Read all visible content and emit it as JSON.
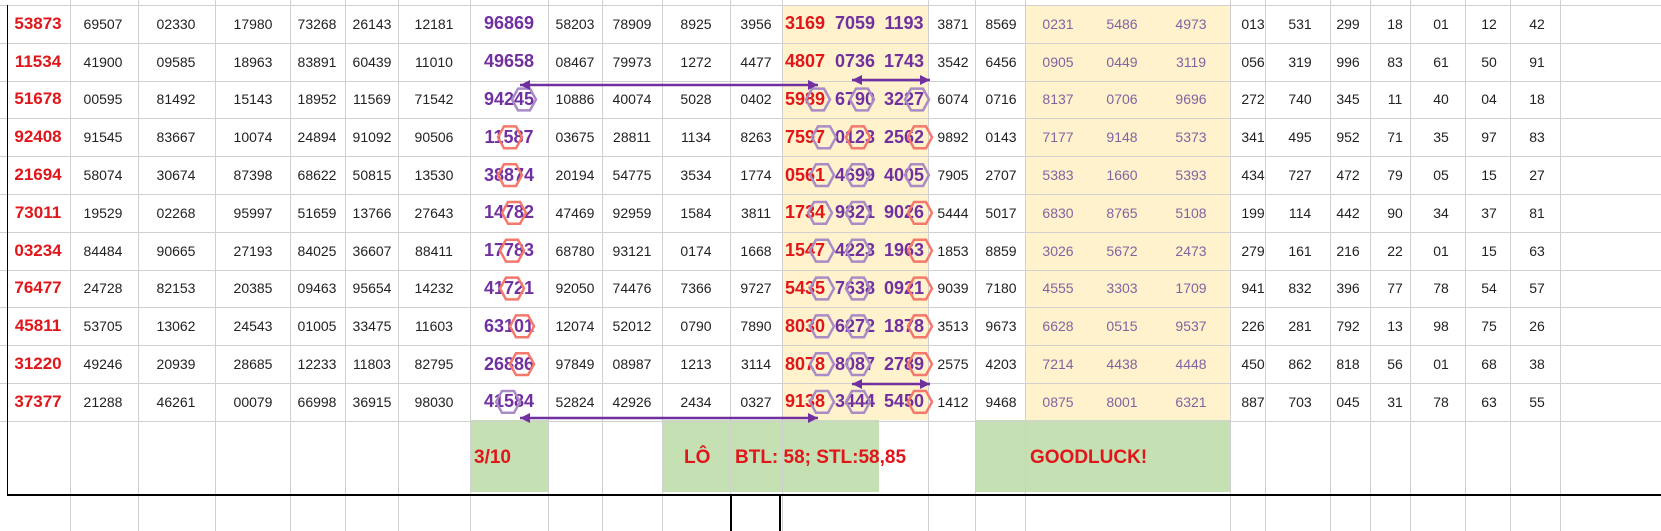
{
  "rows": [
    [
      "53873",
      "69507",
      "02330",
      "17980",
      "73268",
      "26143",
      "12181",
      "96869",
      "58203",
      "78909",
      "8925",
      "3956",
      "3169",
      "7059",
      "1193",
      "3871",
      "8569",
      "0231",
      "5486",
      "4973",
      "013",
      "531",
      "299",
      "18",
      "01",
      "12",
      "42"
    ],
    [
      "11534",
      "41900",
      "09585",
      "18963",
      "83891",
      "60439",
      "11010",
      "49658",
      "08467",
      "79973",
      "1272",
      "4477",
      "4807",
      "0736",
      "1743",
      "3542",
      "6456",
      "0905",
      "0449",
      "3119",
      "056",
      "319",
      "996",
      "83",
      "61",
      "50",
      "91"
    ],
    [
      "51678",
      "00595",
      "81492",
      "15143",
      "18952",
      "11569",
      "71542",
      "94245",
      "10886",
      "40074",
      "5028",
      "0402",
      "5989",
      "6790",
      "3227",
      "6074",
      "0716",
      "8137",
      "0706",
      "9696",
      "272",
      "740",
      "345",
      "11",
      "40",
      "04",
      "18"
    ],
    [
      "92408",
      "91545",
      "83667",
      "10074",
      "24894",
      "91092",
      "90506",
      "11587",
      "03675",
      "28811",
      "1134",
      "8263",
      "7597",
      "0123",
      "2562",
      "9892",
      "0143",
      "7177",
      "9148",
      "5373",
      "341",
      "495",
      "952",
      "71",
      "35",
      "97",
      "83"
    ],
    [
      "21694",
      "58074",
      "30674",
      "87398",
      "68622",
      "50815",
      "13530",
      "38874",
      "20194",
      "54775",
      "3534",
      "1774",
      "0561",
      "4699",
      "4005",
      "7905",
      "2707",
      "5383",
      "1660",
      "5393",
      "434",
      "727",
      "472",
      "79",
      "05",
      "15",
      "27"
    ],
    [
      "73011",
      "19529",
      "02268",
      "95997",
      "51659",
      "13766",
      "27643",
      "14782",
      "47469",
      "92959",
      "1584",
      "3811",
      "1734",
      "9321",
      "9026",
      "5444",
      "5017",
      "6830",
      "8765",
      "5108",
      "199",
      "114",
      "442",
      "90",
      "34",
      "37",
      "81"
    ],
    [
      "03234",
      "84484",
      "90665",
      "27193",
      "84025",
      "36607",
      "88411",
      "17783",
      "68780",
      "93121",
      "0174",
      "1668",
      "1547",
      "4223",
      "1963",
      "1853",
      "8859",
      "3026",
      "5672",
      "2473",
      "279",
      "161",
      "216",
      "22",
      "01",
      "15",
      "63"
    ],
    [
      "76477",
      "24728",
      "82153",
      "20385",
      "09463",
      "95654",
      "14232",
      "41721",
      "92050",
      "74476",
      "7366",
      "9727",
      "5435",
      "7638",
      "0921",
      "9039",
      "7180",
      "4555",
      "3303",
      "1709",
      "941",
      "832",
      "396",
      "77",
      "78",
      "54",
      "57"
    ],
    [
      "45811",
      "53705",
      "13062",
      "24543",
      "01005",
      "33475",
      "11603",
      "63101",
      "12074",
      "52012",
      "0790",
      "7890",
      "8030",
      "6272",
      "1878",
      "3513",
      "9673",
      "6628",
      "0515",
      "9537",
      "226",
      "281",
      "792",
      "13",
      "98",
      "75",
      "26"
    ],
    [
      "31220",
      "49246",
      "20939",
      "28685",
      "12233",
      "11803",
      "82795",
      "26886",
      "97849",
      "08987",
      "1213",
      "3114",
      "8078",
      "8087",
      "2789",
      "2575",
      "4203",
      "7214",
      "4438",
      "4448",
      "450",
      "862",
      "818",
      "56",
      "01",
      "68",
      "38"
    ],
    [
      "37377",
      "21288",
      "46261",
      "00079",
      "66998",
      "36915",
      "98030",
      "41584",
      "52824",
      "42926",
      "2434",
      "0327",
      "9138",
      "3444",
      "5450",
      "1412",
      "9468",
      "0875",
      "8001",
      "6321",
      "887",
      "703",
      "045",
      "31",
      "78",
      "63",
      "55"
    ]
  ],
  "footer": {
    "date": "3/10",
    "lo": "LÔ",
    "btl": "BTL: 58; STL:58,85",
    "goodluck": "GOODLUCK!"
  },
  "colors": {
    "red": "#e0161a",
    "purple": "#7030a0",
    "lavender": "#8064a2",
    "highlight_yellow": "#fff2cc",
    "highlight_green": "#c5e0b3",
    "hex_red": "#f4786b",
    "hex_purple": "#a98bc6"
  },
  "icons": [
    "double-arrow-icon",
    "hexagon-marker-icon"
  ]
}
